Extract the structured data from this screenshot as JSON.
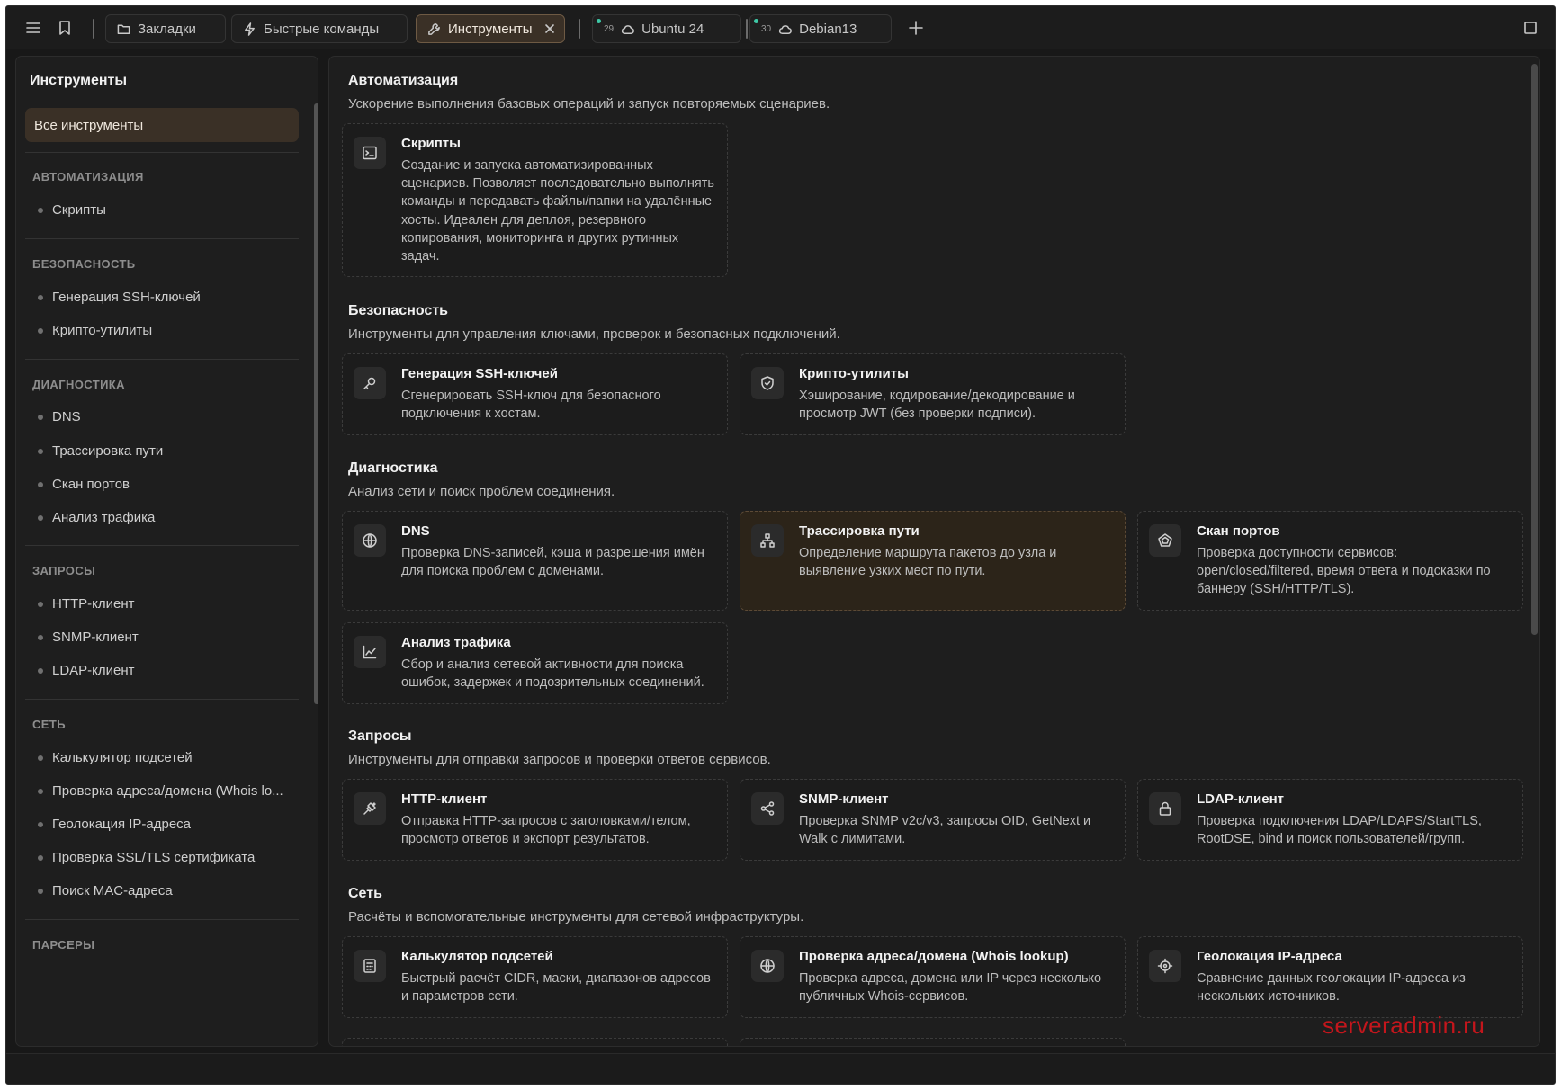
{
  "tabs": [
    {
      "label": "Закладки"
    },
    {
      "label": "Быстрые команды"
    },
    {
      "label": "Инструменты"
    },
    {
      "label": "Ubuntu 24",
      "count": "29"
    },
    {
      "label": "Debian13",
      "count": "30"
    }
  ],
  "sidebar": {
    "title": "Инструменты",
    "all_label": "Все инструменты",
    "groups": [
      {
        "label": "АВТОМАТИЗАЦИЯ",
        "items": [
          "Скрипты"
        ]
      },
      {
        "label": "БЕЗОПАСНОСТЬ",
        "items": [
          "Генерация SSH-ключей",
          "Крипто-утилиты"
        ]
      },
      {
        "label": "ДИАГНОСТИКА",
        "items": [
          "DNS",
          "Трассировка пути",
          "Скан портов",
          "Анализ трафика"
        ]
      },
      {
        "label": "ЗАПРОСЫ",
        "items": [
          "HTTP-клиент",
          "SNMP-клиент",
          "LDAP-клиент"
        ]
      },
      {
        "label": "СЕТЬ",
        "items": [
          "Калькулятор подсетей",
          "Проверка адреса/домена (Whois lo...",
          "Геолокация IP-адреса",
          "Проверка SSL/TLS сертификата",
          "Поиск MAC-адреса"
        ]
      },
      {
        "label": "ПАРСЕРЫ",
        "items": []
      }
    ]
  },
  "sections": [
    {
      "title": "Автоматизация",
      "desc": "Ускорение выполнения базовых операций и запуск повторяемых сценариев.",
      "cards": [
        {
          "icon": "terminal-icon",
          "title": "Скрипты",
          "desc": "Создание и запуска автоматизированных сценариев. Позволяет последовательно выполнять команды и передавать файлы/папки на удалённые хосты. Идеален для деплоя, резервного копирования, мониторинга и других рутинных задач."
        }
      ]
    },
    {
      "title": "Безопасность",
      "desc": "Инструменты для управления ключами, проверок и безопасных подключений.",
      "cards": [
        {
          "icon": "key-icon",
          "title": "Генерация SSH-ключей",
          "desc": "Сгенерировать SSH-ключ для безопасного подключения к хостам."
        },
        {
          "icon": "shield-icon",
          "title": "Крипто-утилиты",
          "desc": "Хэширование, кодирование/декодирование и просмотр JWT (без проверки подписи)."
        }
      ]
    },
    {
      "title": "Диагностика",
      "desc": "Анализ сети и поиск проблем соединения.",
      "cards": [
        {
          "icon": "globe-icon",
          "title": "DNS",
          "desc": "Проверка DNS-записей, кэша и разрешения имён для поиска проблем с доменами."
        },
        {
          "icon": "network-tree-icon",
          "title": "Трассировка пути",
          "desc": "Определение маршрута пакетов до узла и выявление узких мест по пути."
        },
        {
          "icon": "radar-icon",
          "title": "Скан портов",
          "desc": "Проверка доступности сервисов: open/closed/filtered, время ответа и подсказки по баннеру (SSH/HTTP/TLS)."
        },
        {
          "icon": "chart-line-icon",
          "title": "Анализ трафика",
          "desc": "Сбор и анализ сетевой активности для поиска ошибок, задержек и подозрительных соединений."
        }
      ]
    },
    {
      "title": "Запросы",
      "desc": "Инструменты для отправки запросов и проверки ответов сервисов.",
      "cards": [
        {
          "icon": "plug-icon",
          "title": "HTTP-клиент",
          "desc": "Отправка HTTP-запросов с заголовками/телом, просмотр ответов и экспорт результатов."
        },
        {
          "icon": "share-nodes-icon",
          "title": "SNMP-клиент",
          "desc": "Проверка SNMP v2c/v3, запросы OID, GetNext и Walk с лимитами."
        },
        {
          "icon": "lock-icon",
          "title": "LDAP-клиент",
          "desc": "Проверка подключения LDAP/LDAPS/StartTLS, RootDSE, bind и поиск пользователей/групп."
        }
      ]
    },
    {
      "title": "Сеть",
      "desc": "Расчёты и вспомогательные инструменты для сетевой инфраструктуры.",
      "cards": [
        {
          "icon": "calculator-icon",
          "title": "Калькулятор подсетей",
          "desc": "Быстрый расчёт CIDR, маски, диапазонов адресов и параметров сети."
        },
        {
          "icon": "globe-icon",
          "title": "Проверка адреса/домена (Whois lookup)",
          "desc": "Проверка адреса, домена или IP через несколько публичных Whois-сервисов."
        },
        {
          "icon": "crosshair-icon",
          "title": "Геолокация IP-адреса",
          "desc": "Сравнение данных геолокации IP-адреса из нескольких источников."
        }
      ]
    }
  ],
  "watermark": "serveradmin.ru",
  "colors": {
    "accent_bg": "#3a3026",
    "accent_border": "#6e5a44",
    "online_dot": "#3ec9a7",
    "watermark": "#c4161c"
  }
}
